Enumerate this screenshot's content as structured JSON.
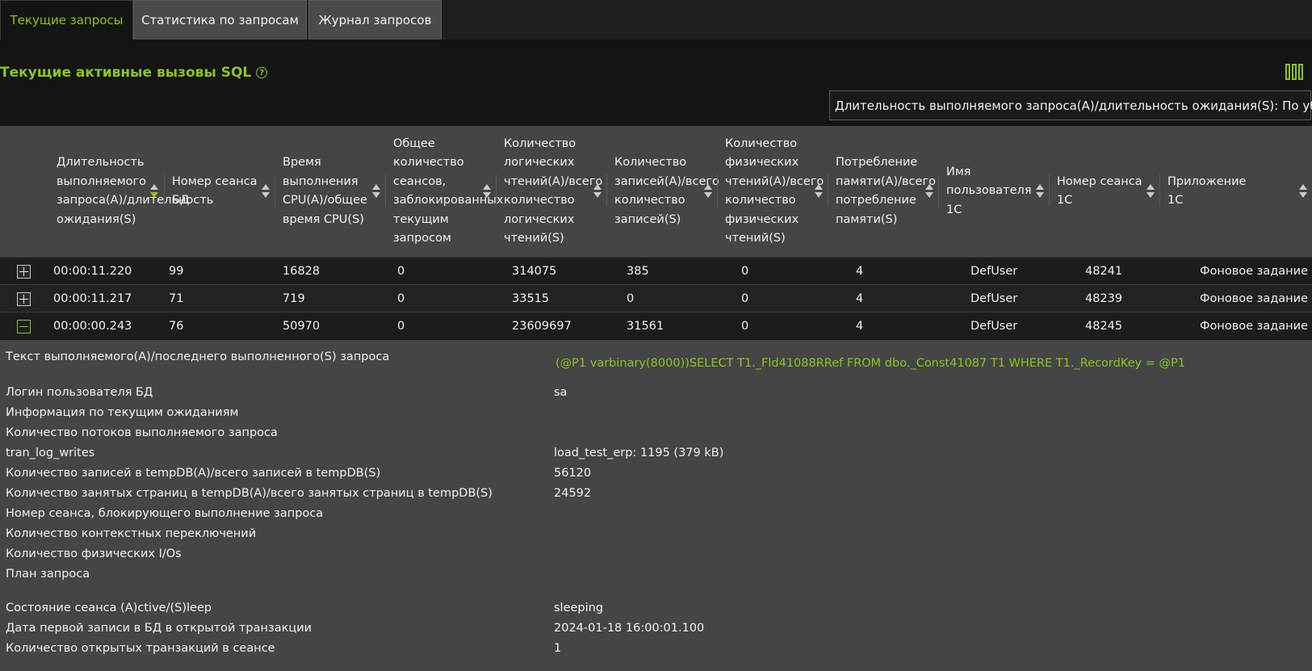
{
  "tabs": [
    "Текущие запросы",
    "Статистика по запросам",
    "Журнал запросов"
  ],
  "section": {
    "title": "Текущие активные вызовы SQL",
    "help_icon": "help-circle-icon",
    "columns_icon": "columns-icon"
  },
  "sort_label": "Длительность выполняемого запроса(A)/длительность ожидания(S): По убыванию",
  "columns": [
    "Длительность\nвыполняемого\nзапроса(A)/длительность\nожидания(S)",
    "Номер сеанса\nБД",
    "Время\nвыполнения\nCPU(A)/общее\nвремя CPU(S)",
    "Общее\nколичество\nсеансов,\nзаблокированных\nтекущим\nзапросом",
    "Количество\nлогических\nчтений(A)/всего\nколичество\nлогических\nчтений(S)",
    "Количество\nзаписей(A)/всего\nколичество\nзаписей(S)",
    "Количество\nфизических\nчтений(A)/всего\nколичество\nфизических\nчтений(S)",
    "Потребление\nпамяти(A)/всего\nпотребление\nпамяти(S)",
    "Имя\nпользователя\n1С",
    "Номер сеанса\n1С",
    "Приложение\n1С"
  ],
  "rows": [
    {
      "expand": "+",
      "cells": [
        "00:00:11.220",
        "99",
        "16828",
        "0",
        "314075",
        "385",
        "0",
        "4",
        "DefUser",
        "48241",
        "Фоновое задание"
      ]
    },
    {
      "expand": "+",
      "cells": [
        "00:00:11.217",
        "71",
        "719",
        "0",
        "33515",
        "0",
        "0",
        "4",
        "DefUser",
        "48239",
        "Фоновое задание"
      ]
    },
    {
      "expand": "−",
      "cells": [
        "00:00:00.243",
        "76",
        "50970",
        "0",
        "23609697",
        "31561",
        "0",
        "4",
        "DefUser",
        "48245",
        "Фоновое задание"
      ]
    }
  ],
  "details": [
    {
      "label": "Текст выполняемого(A)/последнего выполненного(S) запроса",
      "value": "(@P1 varbinary(8000))SELECT T1._Fld41088RRef FROM dbo._Const41087 T1 WHERE T1._RecordKey = @P1"
    },
    {
      "label": "Логин пользователя БД",
      "value": "sa"
    },
    {
      "label": "Информация по текущим ожиданиям",
      "value": ""
    },
    {
      "label": "Количество потоков выполняемого запроса",
      "value": ""
    },
    {
      "label": "tran_log_writes",
      "value": "load_test_erp: 1195 (379 kB)"
    },
    {
      "label": "Количество записей в tempDB(A)/всего записей в tempDB(S)",
      "value": "56120"
    },
    {
      "label": "Количество занятых страниц в tempDB(A)/всего занятых страниц в tempDB(S)",
      "value": "24592"
    },
    {
      "label": "Номер сеанса, блокирующего выполнение запроса",
      "value": ""
    },
    {
      "label": "Количество контекстных переключений",
      "value": ""
    },
    {
      "label": "Количество физических I/Os",
      "value": ""
    },
    {
      "label": "План запроса",
      "value": ""
    },
    {
      "label": "Состояние сеанса (A)ctive/(S)leep",
      "value": "sleeping"
    },
    {
      "label": "Дата первой записи в БД в открытой транзакции",
      "value": "2024-01-18 16:00:01.100"
    },
    {
      "label": "Количество открытых транзакций в сеансе",
      "value": "1"
    }
  ],
  "colors": {
    "accent": "#8fc31f",
    "header_bg": "#454545",
    "page_bg": "#141414"
  }
}
